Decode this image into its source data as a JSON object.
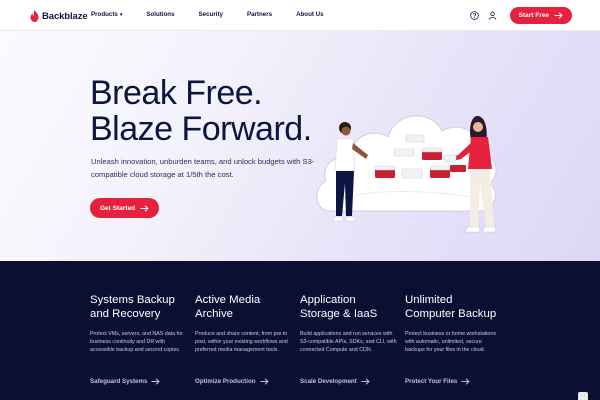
{
  "nav": {
    "logo_text": "Backblaze",
    "links": [
      "Products",
      "Solutions",
      "Security",
      "Partners",
      "About Us"
    ],
    "cta": "Start Free",
    "icons": [
      "help-icon",
      "user-icon",
      "arrow-right-icon"
    ]
  },
  "hero": {
    "title_line1": "Break Free.",
    "title_line2": "Blaze Forward.",
    "subtitle": "Unleash innovation, unburden teams, and unlock budgets with S3-compatible cloud storage at 1/5th the cost.",
    "cta": "Get Started"
  },
  "features": [
    {
      "title": "Systems Backup and Recovery",
      "text": "Protect VMs, servers, and NAS data for business continuity and DR with accessible backup and second copies.",
      "link": "Safeguard Systems"
    },
    {
      "title": "Active Media Archive",
      "text": "Produce and share content, from pre to post, within your existing workflows and preferred media management tools.",
      "link": "Optimize Production"
    },
    {
      "title": "Application Storage & IaaS",
      "text": "Build applications and run services with S3-compatible APIs, SDKs, and CLI, with connected Compute and CDN.",
      "link": "Scale Development"
    },
    {
      "title": "Unlimited Computer Backup",
      "text": "Protect business or home workstations with automatic, unlimited, secure backups for your files in the cloud.",
      "link": "Protect Your Files"
    }
  ],
  "colors": {
    "brand_red": "#e5213e",
    "navy": "#0b1540",
    "dark_bg": "#0b1033",
    "link_lavender": "#b9c0f0"
  }
}
